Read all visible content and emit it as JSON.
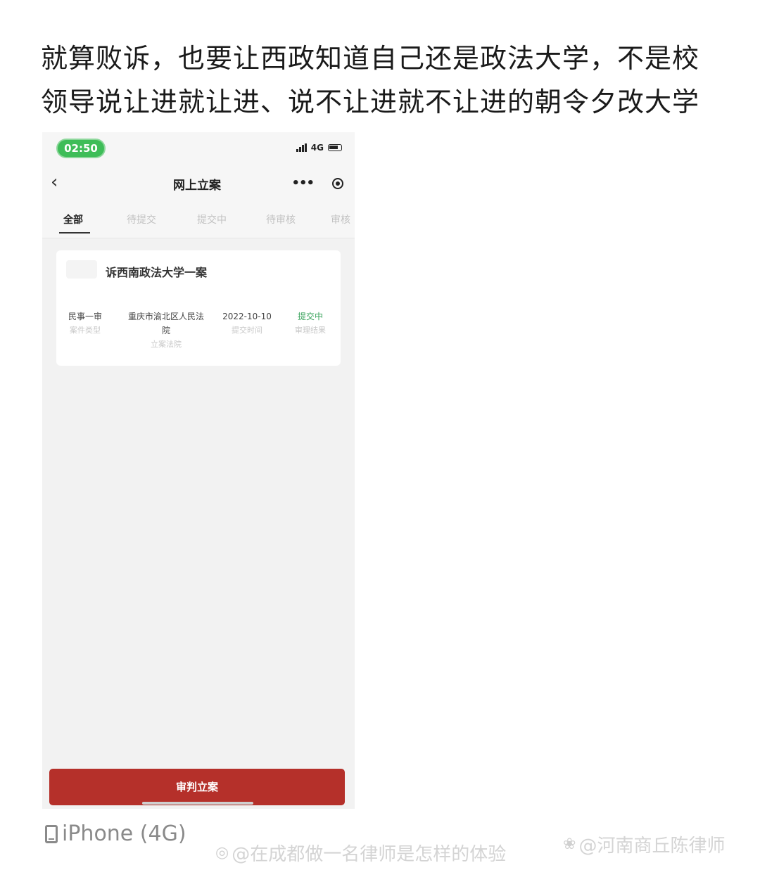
{
  "headline": {
    "line1": "就算败诉，也要让西政知道自己还是政法大学，不是校",
    "line2": "领导说让进就让进、说不让进就不让进的朝令夕改大学"
  },
  "status_bar": {
    "time": "02:50",
    "network": "4G"
  },
  "nav": {
    "back_icon": "chevron-left",
    "title": "网上立案",
    "more_icon": "more-dots",
    "close_icon": "target-circle"
  },
  "tabs": [
    {
      "label": "全部",
      "active": true
    },
    {
      "label": "待提交",
      "active": false
    },
    {
      "label": "提交中",
      "active": false
    },
    {
      "label": "待审核",
      "active": false
    },
    {
      "label": "审核",
      "active": false
    }
  ],
  "case_card": {
    "title": "诉西南政法大学一案",
    "fields": [
      {
        "value": "民事一审",
        "label": "案件类型"
      },
      {
        "value": "重庆市渝北区人民法院",
        "value_line1": "重庆市渝北区人民法",
        "value_line2": "院",
        "label": "立案法院"
      },
      {
        "value": "2022-10-10",
        "label": "提交时间"
      },
      {
        "value": "提交中",
        "label": "审理结果",
        "color": "#3aa35c"
      }
    ]
  },
  "bottom_button": {
    "label": "审判立案",
    "color": "#b5302a"
  },
  "device_label": "iPhone (4G)",
  "watermarks": {
    "left": "@在成都做一名律师是怎样的体验",
    "right": "@河南商丘陈律师"
  }
}
